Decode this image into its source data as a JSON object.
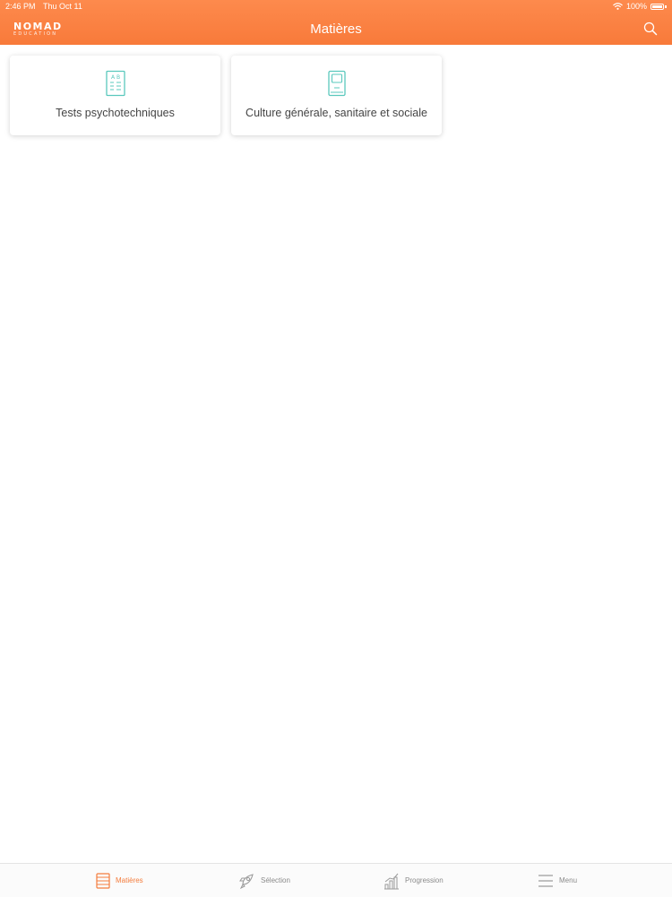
{
  "status_bar": {
    "time": "2:46 PM",
    "date": "Thu Oct 11",
    "battery": "100%"
  },
  "header": {
    "logo_main": "NOMAD",
    "logo_sub": "EDUCATION",
    "title": "Matières",
    "search_icon": "search-icon"
  },
  "subjects": [
    {
      "label": "Tests psychotechniques",
      "icon": "test-sheet-icon"
    },
    {
      "label": "Culture générale, sanitaire et sociale",
      "icon": "book-icon"
    }
  ],
  "tabbar": {
    "tabs": [
      {
        "label": "Matières",
        "icon": "books-icon",
        "active": true
      },
      {
        "label": "Sélection",
        "icon": "rocket-icon",
        "active": false
      },
      {
        "label": "Progression",
        "icon": "chart-icon",
        "active": false
      },
      {
        "label": "Menu",
        "icon": "menu-icon",
        "active": false
      }
    ]
  },
  "colors": {
    "header": "#f87a3a",
    "accent": "#f47c3c",
    "icon_teal": "#5ac8bd"
  }
}
